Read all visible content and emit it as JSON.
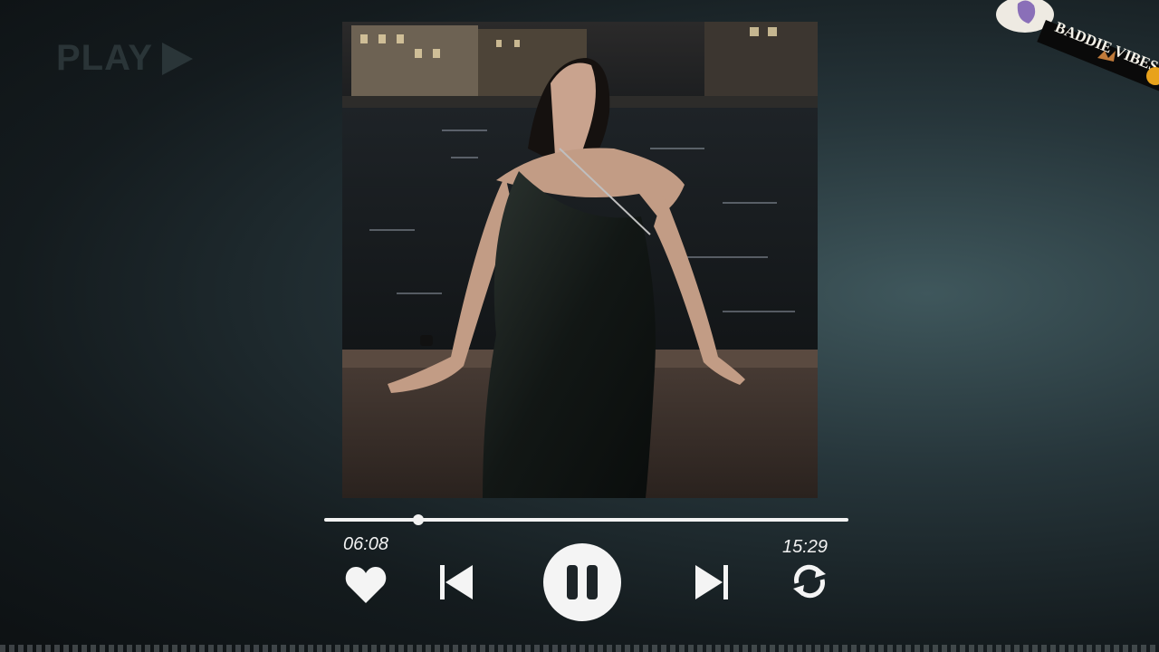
{
  "watermark": {
    "label": "PLAY",
    "icon": "play-triangle-icon"
  },
  "sticker": {
    "text": "BADDIE VIBES"
  },
  "player": {
    "elapsed": "06:08",
    "total": "15:29",
    "progress": 0.18,
    "controls": {
      "like": "heart-icon",
      "previous": "skip-previous-icon",
      "pause": "pause-icon",
      "next": "skip-next-icon",
      "repeat": "repeat-icon"
    }
  },
  "colors": {
    "accent": "#f2f2f2",
    "background": "#1b2326"
  }
}
